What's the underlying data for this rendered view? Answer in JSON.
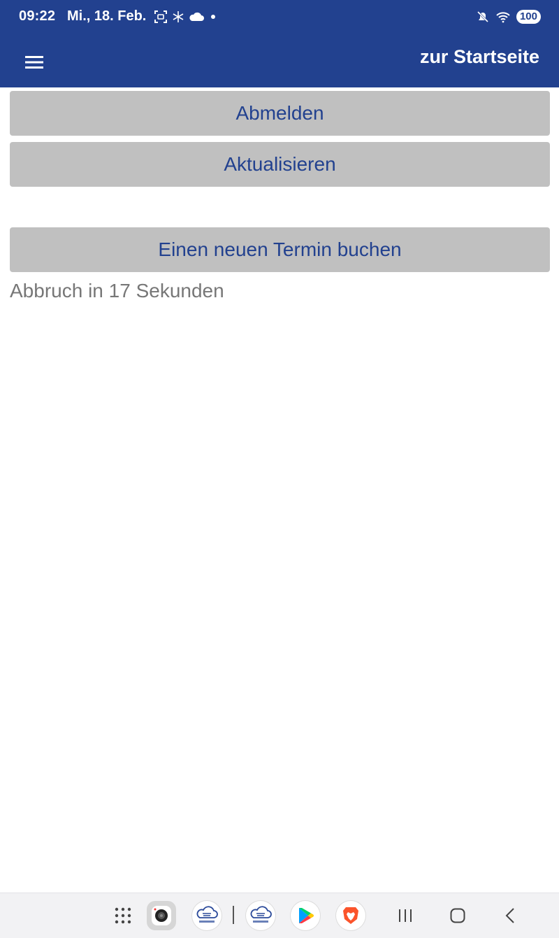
{
  "status_bar": {
    "time": "09:22",
    "date": "Mi., 18. Feb.",
    "battery": "100",
    "icons_left": [
      "screenshot-icon",
      "snowflake-icon",
      "cloud-icon",
      "dot-icon"
    ],
    "icons_right": [
      "mute-icon",
      "wifi-icon",
      "battery-icon"
    ]
  },
  "app_bar": {
    "menu_icon": "hamburger-menu-icon",
    "home_link": "zur Startseite",
    "color": "#22418f"
  },
  "main": {
    "logout_label": "Abmelden",
    "refresh_label": "Aktualisieren",
    "book_label": "Einen neuen Termin buchen",
    "countdown": "Abbruch in 17 Sekunden",
    "button_bg": "#c0c0c0",
    "button_text_color": "#22418f"
  },
  "nav_bar": {
    "apps": [
      "app-drawer-icon",
      "camera-app-icon",
      "chip-cloud-app-icon",
      "chip-cloud-app-icon",
      "play-store-icon",
      "brave-browser-icon"
    ],
    "system": [
      "recents-icon",
      "home-icon",
      "back-icon"
    ]
  }
}
